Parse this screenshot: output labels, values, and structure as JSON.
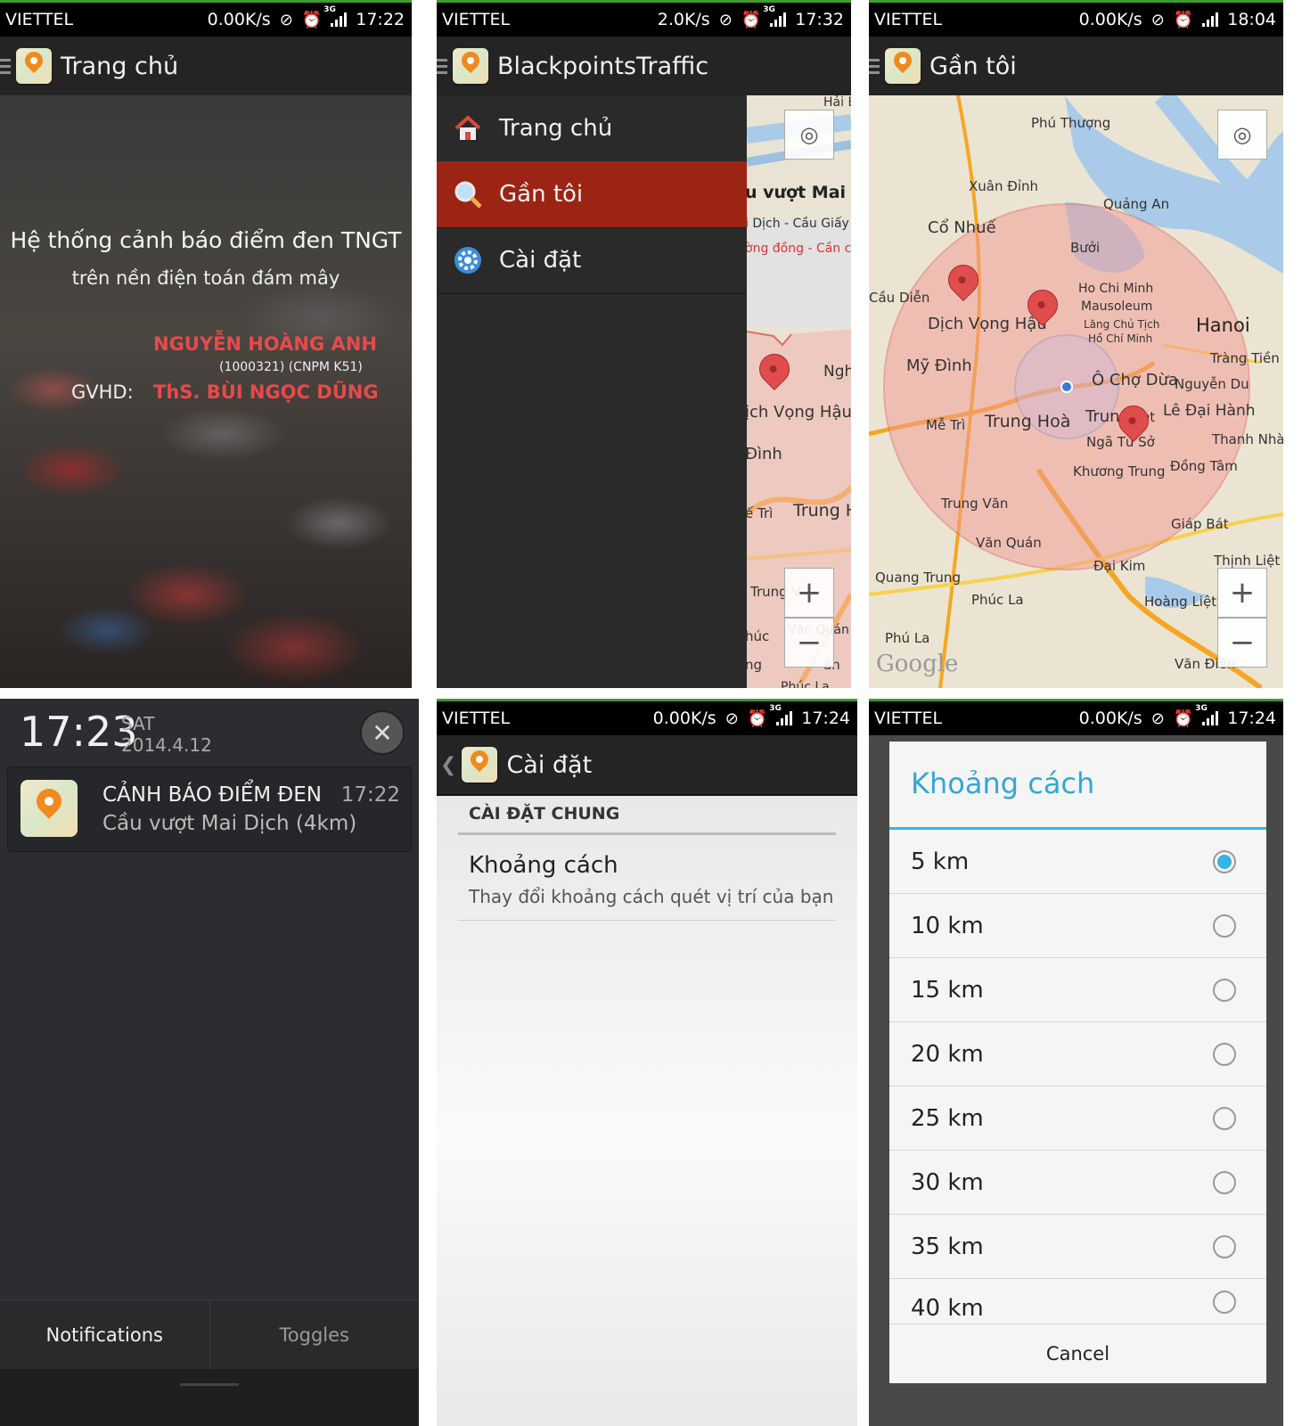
{
  "colors": {
    "accent_red": "#9c2414",
    "holo_blue": "#33b5e5",
    "author_red": "#e84a4a",
    "status_green": "#3f9b2a"
  },
  "screens": {
    "home": {
      "status": {
        "carrier": "VIETTEL",
        "speed": "0.00K/s",
        "time": "17:22"
      },
      "title": "Trang chủ",
      "headline": "Hệ thống cảnh báo điểm đen TNGT",
      "subheadline": "trên nền điện toán đám mây",
      "author": "NGUYỄN HOÀNG ANH",
      "author_code": "(1000321) (CNPM K51)",
      "advisor_label": "GVHD:",
      "advisor": "ThS. BÙI NGỌC DŨNG"
    },
    "drawer": {
      "status": {
        "carrier": "VIETTEL",
        "speed": "2.0K/s",
        "time": "17:32"
      },
      "title": "BlackpointsTraffic",
      "items": [
        {
          "label": "Trang chủ",
          "icon": "home-icon"
        },
        {
          "label": "Gần tôi",
          "icon": "search-icon",
          "active": true
        },
        {
          "label": "Cài đặt",
          "icon": "gear-icon"
        }
      ],
      "map_peek": {
        "labels": [
          "Hải B",
          "u vượt Mai Dị",
          "i Dịch - Cầu Giấy",
          "ờng đồng - Cần c",
          "Ngh",
          "ịch Vọng Hậu",
          "Đình",
          "ế Trì",
          "Trung H",
          "Trung V",
          "Văn Quán",
          "húc",
          "ng",
          "ăn",
          "Phúc La"
        ]
      }
    },
    "near_me": {
      "status": {
        "carrier": "VIETTEL",
        "speed": "0.00K/s",
        "time": "18:04"
      },
      "title": "Gần tôi",
      "map_labels": [
        "Phú Thượng",
        "Xuân Đỉnh",
        "Quảng An",
        "Cổ Nhuế",
        "Bưởi",
        "Cầu Diễn",
        "Ho Chi Minh",
        "Mausoleum",
        "Lăng Chủ Tịch",
        "Hồ Chí Minh",
        "Dịch Vọng Hậu",
        "Hanoi",
        "Mỹ Đình",
        "Tràng Tiền",
        "Ô Chợ Dừa",
        "Nguyễn Du",
        "Mễ Trì",
        "Trung Hoà",
        "Trun",
        "et",
        "Lê Đại Hành",
        "Ngã Tư Sở",
        "Thanh Nhà",
        "Khương Trung",
        "Đồng Tâm",
        "Trung Văn",
        "Giáp Bát",
        "Văn Quán",
        "Đại Kim",
        "Thịnh Liệt",
        "Quang Trung",
        "Phúc La",
        "Hoàng Liệt",
        "Phú La",
        "Google",
        "Văn Điển"
      ],
      "zoom_in": "+",
      "zoom_out": "−"
    },
    "notification": {
      "clock": "17:23",
      "day": "SAT",
      "date": "2014.4.12",
      "title": "CẢNH BÁO ĐIỂM ĐEN",
      "time": "17:22",
      "text": "Cầu vượt Mai Dịch (4km)",
      "tabs": [
        "Notifications",
        "Toggles"
      ]
    },
    "settings": {
      "status": {
        "carrier": "VIETTEL",
        "speed": "0.00K/s",
        "time": "17:24"
      },
      "title": "Cài đặt",
      "section": "CÀI ĐẶT CHUNG",
      "pref_title": "Khoảng cách",
      "pref_summary": "Thay đổi khoảng cách quét vị trí của bạn"
    },
    "distance_dialog": {
      "status": {
        "carrier": "VIETTEL",
        "speed": "0.00K/s",
        "time": "17:24"
      },
      "title": "Khoảng cách",
      "options": [
        "5 km",
        "10 km",
        "15 km",
        "20 km",
        "25 km",
        "30 km",
        "35 km",
        "40 km"
      ],
      "selected": "5 km",
      "cancel": "Cancel"
    }
  }
}
